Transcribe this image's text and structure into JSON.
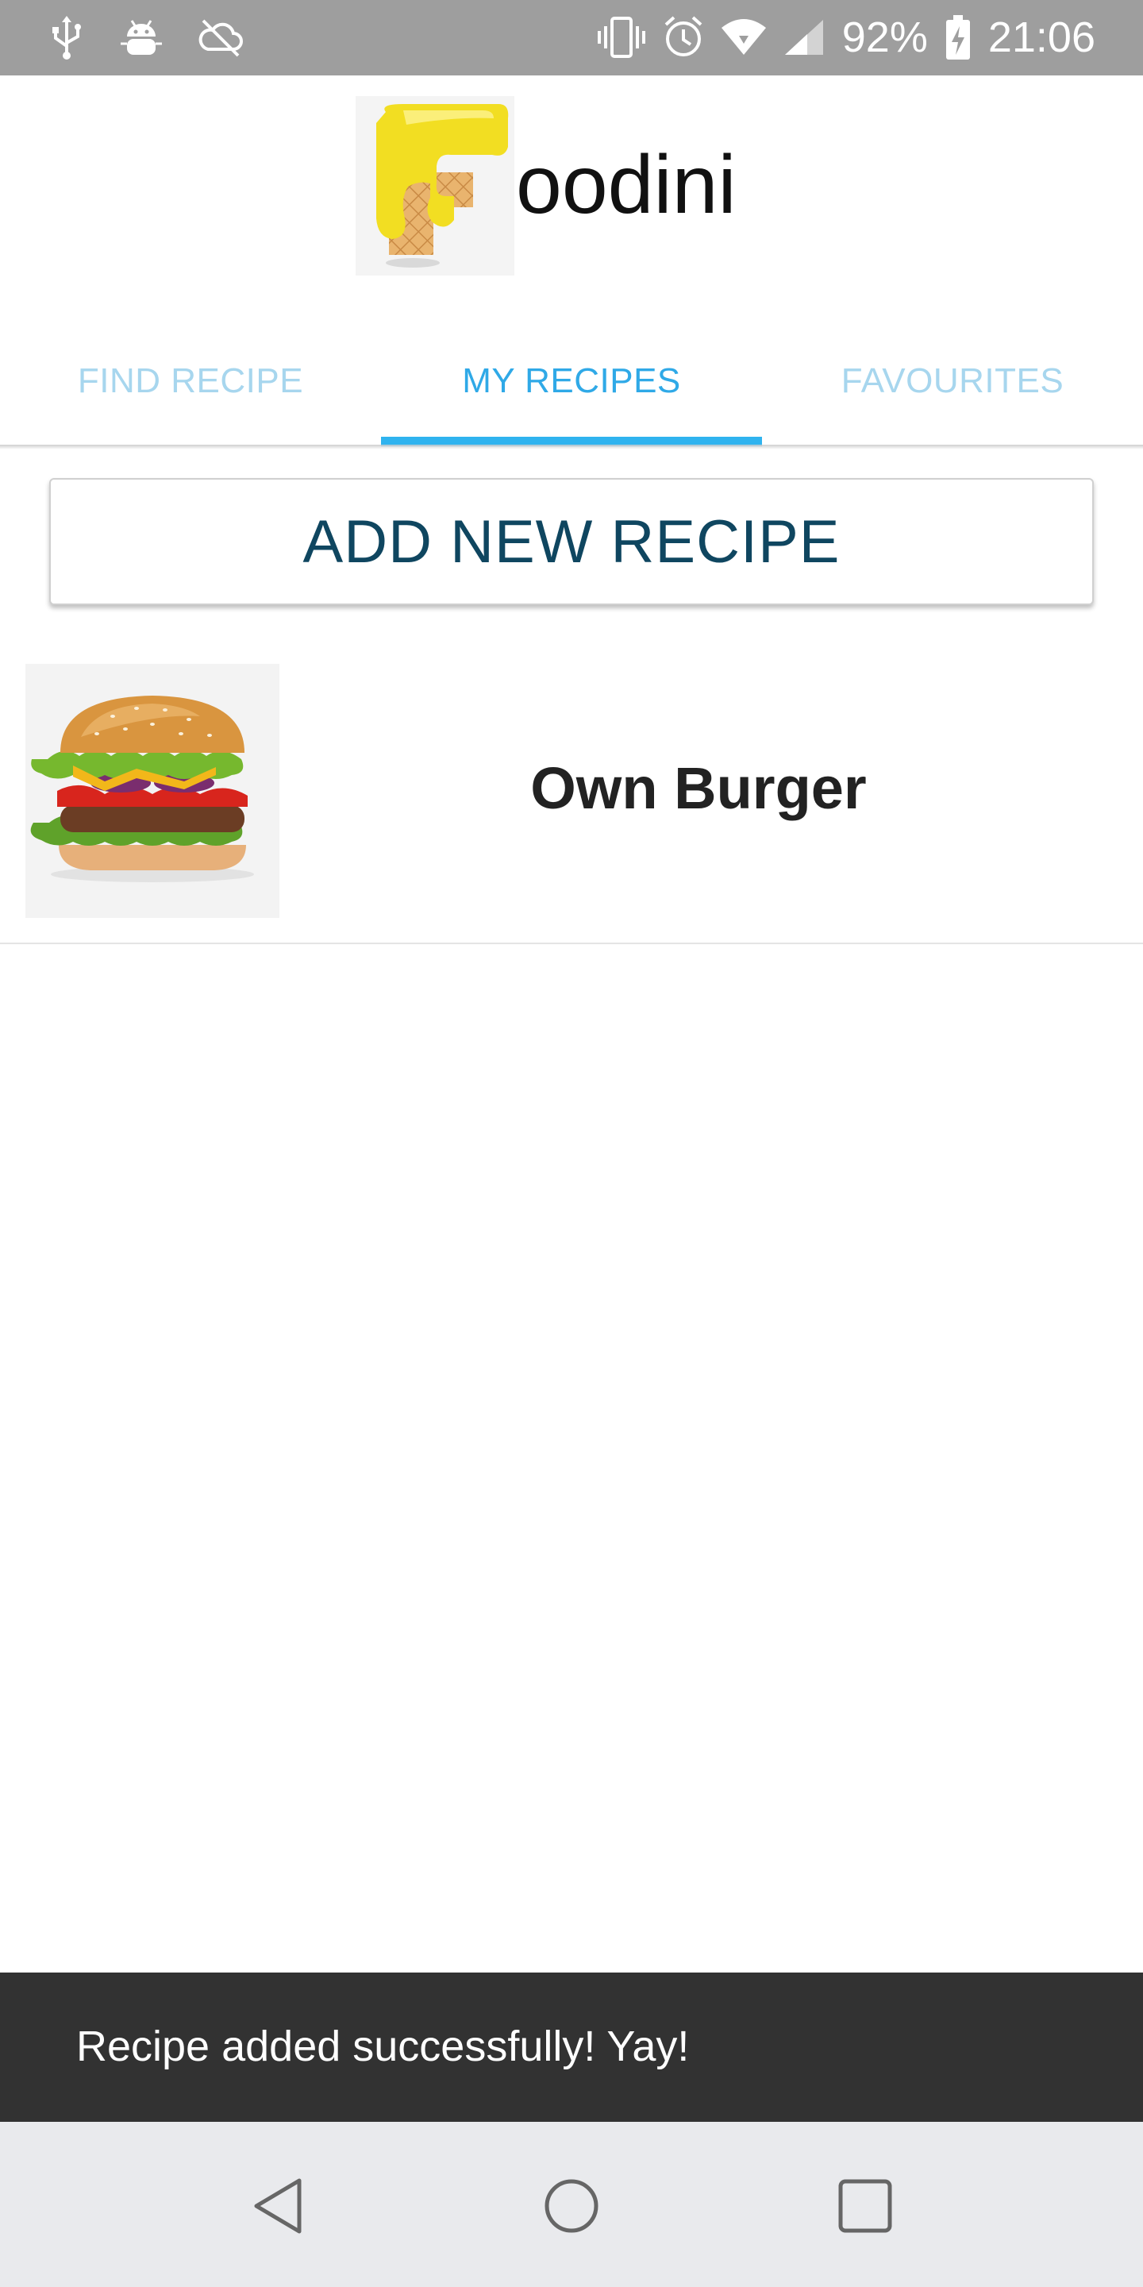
{
  "status_bar": {
    "battery_percent": "92%",
    "time": "21:06",
    "left_icons": [
      "usb-icon",
      "android-debug-icon",
      "no-sync-icon"
    ],
    "right_icons": [
      "vibrate-icon",
      "alarm-icon",
      "wifi-icon",
      "signal-icon",
      "battery-charging-icon"
    ]
  },
  "app": {
    "logo_letter_icon": "waffle-f-logo-icon",
    "logo_suffix": "oodini"
  },
  "tabs": [
    {
      "label": "FIND RECIPE",
      "active": false
    },
    {
      "label": "MY RECIPES",
      "active": true
    },
    {
      "label": "FAVOURITES",
      "active": false
    }
  ],
  "main": {
    "add_button_label": "ADD NEW RECIPE",
    "recipes": [
      {
        "title": "Own Burger",
        "image_icon": "burger-image"
      }
    ]
  },
  "snackbar": {
    "message": "Recipe added successfully! Yay!"
  },
  "nav_bar": {
    "icons": [
      "back-icon",
      "home-icon",
      "recents-icon"
    ]
  },
  "colors": {
    "status_bar": "#9e9e9e",
    "tab_active": "#2fa9e7",
    "tab_inactive": "#a7d6ee",
    "button_text": "#0f4660",
    "snackbar_bg": "#323232",
    "nav_bar_bg": "#e9eaed"
  }
}
